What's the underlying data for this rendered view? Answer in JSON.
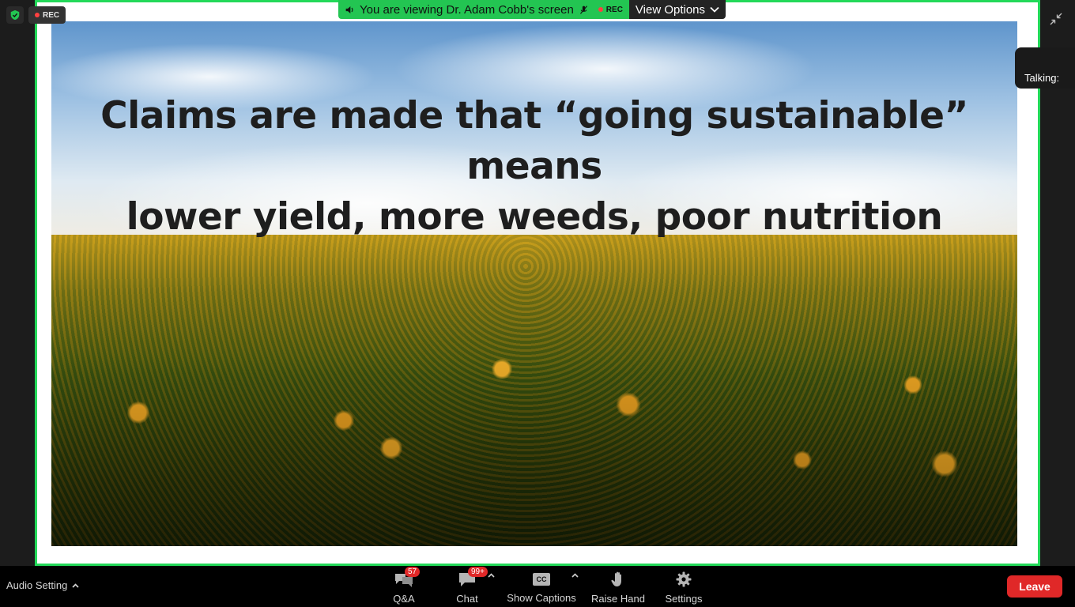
{
  "top": {
    "rec_label": "REC",
    "viewing_text": "You are viewing Dr. Adam Cobb's screen",
    "viewing_rec_label": "REC",
    "view_options_label": "View Options",
    "talking_label": "Talking:"
  },
  "slide": {
    "title_line1": "Claims are made that “going sustainable” means",
    "title_line2": "lower yield, more weeds, poor nutrition"
  },
  "toolbar": {
    "audio_setting_label": "Audio Setting",
    "qa_label": "Q&A",
    "qa_badge": "57",
    "chat_label": "Chat",
    "chat_badge": "99+",
    "captions_label": "Show Captions",
    "cc_text": "CC",
    "raise_hand_label": "Raise Hand",
    "settings_label": "Settings",
    "leave_label": "Leave"
  },
  "colors": {
    "share_border": "#23d959",
    "viewing_bar": "#23c552",
    "leave": "#e02828",
    "badge": "#e02828"
  },
  "icons": [
    "shield-check-icon",
    "speaker-icon",
    "mic-muted-icon",
    "collapse-icon",
    "qa-bubbles-icon",
    "chat-bubble-icon",
    "cc-icon",
    "hand-icon",
    "gear-icon",
    "chevron-up-icon",
    "chevron-down-icon"
  ]
}
